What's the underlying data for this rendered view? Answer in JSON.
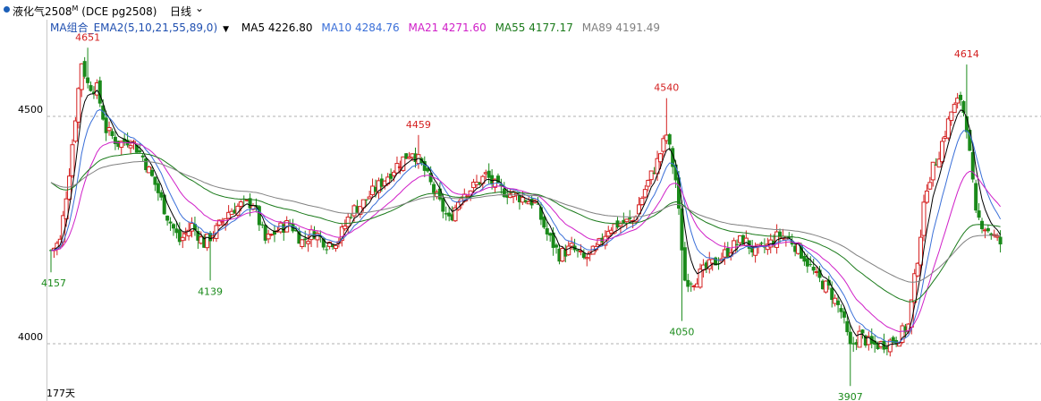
{
  "header": {
    "symbol": "液化气2508",
    "symbol_sup": "M",
    "code": "(DCE pg2508)",
    "period": "日线"
  },
  "indicators": {
    "label": "MA组合_EMA2(5,10,21,55,89,0)",
    "items": [
      {
        "text": "MA5 4226.80",
        "color": "#000000"
      },
      {
        "text": "MA10 4284.76",
        "color": "#3a6fd8"
      },
      {
        "text": "MA21 4271.60",
        "color": "#d020c8"
      },
      {
        "text": "MA55 4177.17",
        "color": "#1a7a1a"
      },
      {
        "text": "MA89 4191.49",
        "color": "#808080"
      }
    ]
  },
  "footer": {
    "days": "177天"
  },
  "chart_data": {
    "type": "candlestick",
    "y_ticks": [
      4500,
      4000
    ],
    "ylim": [
      3880,
      4680
    ],
    "colors": {
      "up": "#d42020",
      "down": "#1a8a1a",
      "grid": "#b0b0b0"
    },
    "annotations": [
      {
        "text": "4651",
        "value": 4651,
        "bar": 12,
        "color": "#d42020",
        "pos": "above"
      },
      {
        "text": "4459",
        "value": 4459,
        "bar": 120,
        "color": "#d42020",
        "pos": "above"
      },
      {
        "text": "4540",
        "value": 4540,
        "bar": 201,
        "color": "#d42020",
        "pos": "above"
      },
      {
        "text": "4614",
        "value": 4614,
        "bar": 299,
        "color": "#d42020",
        "pos": "above"
      },
      {
        "text": "4157",
        "value": 4157,
        "bar": 0,
        "color": "#1a8a1a",
        "pos": "below"
      },
      {
        "text": "4139",
        "value": 4139,
        "bar": 52,
        "color": "#1a8a1a",
        "pos": "below"
      },
      {
        "text": "4050",
        "value": 4050,
        "bar": 206,
        "color": "#1a8a1a",
        "pos": "below"
      },
      {
        "text": "3907",
        "value": 3907,
        "bar": 261,
        "color": "#1a8a1a",
        "pos": "below"
      }
    ],
    "anchors": [
      [
        0,
        4205
      ],
      [
        3,
        4225
      ],
      [
        6,
        4380
      ],
      [
        10,
        4620
      ],
      [
        12,
        4570
      ],
      [
        15,
        4560
      ],
      [
        18,
        4470
      ],
      [
        22,
        4440
      ],
      [
        26,
        4450
      ],
      [
        30,
        4410
      ],
      [
        34,
        4350
      ],
      [
        38,
        4280
      ],
      [
        42,
        4225
      ],
      [
        46,
        4260
      ],
      [
        50,
        4220
      ],
      [
        54,
        4250
      ],
      [
        58,
        4290
      ],
      [
        62,
        4305
      ],
      [
        66,
        4310
      ],
      [
        70,
        4225
      ],
      [
        74,
        4250
      ],
      [
        78,
        4265
      ],
      [
        82,
        4225
      ],
      [
        86,
        4245
      ],
      [
        90,
        4220
      ],
      [
        94,
        4230
      ],
      [
        98,
        4290
      ],
      [
        102,
        4310
      ],
      [
        106,
        4340
      ],
      [
        110,
        4370
      ],
      [
        114,
        4400
      ],
      [
        118,
        4425
      ],
      [
        122,
        4380
      ],
      [
        126,
        4320
      ],
      [
        130,
        4270
      ],
      [
        134,
        4330
      ],
      [
        138,
        4345
      ],
      [
        142,
        4370
      ],
      [
        146,
        4340
      ],
      [
        150,
        4330
      ],
      [
        154,
        4320
      ],
      [
        158,
        4310
      ],
      [
        162,
        4240
      ],
      [
        166,
        4195
      ],
      [
        170,
        4210
      ],
      [
        174,
        4185
      ],
      [
        178,
        4205
      ],
      [
        182,
        4255
      ],
      [
        186,
        4265
      ],
      [
        190,
        4270
      ],
      [
        194,
        4340
      ],
      [
        198,
        4400
      ],
      [
        201,
        4460
      ],
      [
        204,
        4360
      ],
      [
        207,
        4140
      ],
      [
        210,
        4140
      ],
      [
        214,
        4165
      ],
      [
        218,
        4185
      ],
      [
        222,
        4210
      ],
      [
        226,
        4230
      ],
      [
        230,
        4200
      ],
      [
        234,
        4215
      ],
      [
        238,
        4240
      ],
      [
        242,
        4225
      ],
      [
        246,
        4190
      ],
      [
        250,
        4145
      ],
      [
        254,
        4120
      ],
      [
        258,
        4070
      ],
      [
        261,
        3990
      ],
      [
        264,
        4020
      ],
      [
        268,
        3995
      ],
      [
        272,
        4000
      ],
      [
        276,
        4010
      ],
      [
        280,
        4040
      ],
      [
        283,
        4190
      ],
      [
        286,
        4350
      ],
      [
        290,
        4420
      ],
      [
        294,
        4510
      ],
      [
        297,
        4540
      ],
      [
        299,
        4480
      ],
      [
        302,
        4280
      ],
      [
        306,
        4250
      ],
      [
        310,
        4220
      ]
    ],
    "ma": [
      {
        "name": "MA5",
        "color": "#000000",
        "value": 4226.8
      },
      {
        "name": "MA10",
        "color": "#3a6fd8",
        "value": 4284.76
      },
      {
        "name": "MA21",
        "color": "#d020c8",
        "value": 4271.6
      },
      {
        "name": "MA55",
        "color": "#1a7a1a",
        "value": 4177.17
      },
      {
        "name": "MA89",
        "color": "#808080",
        "value": 4191.49
      }
    ]
  }
}
